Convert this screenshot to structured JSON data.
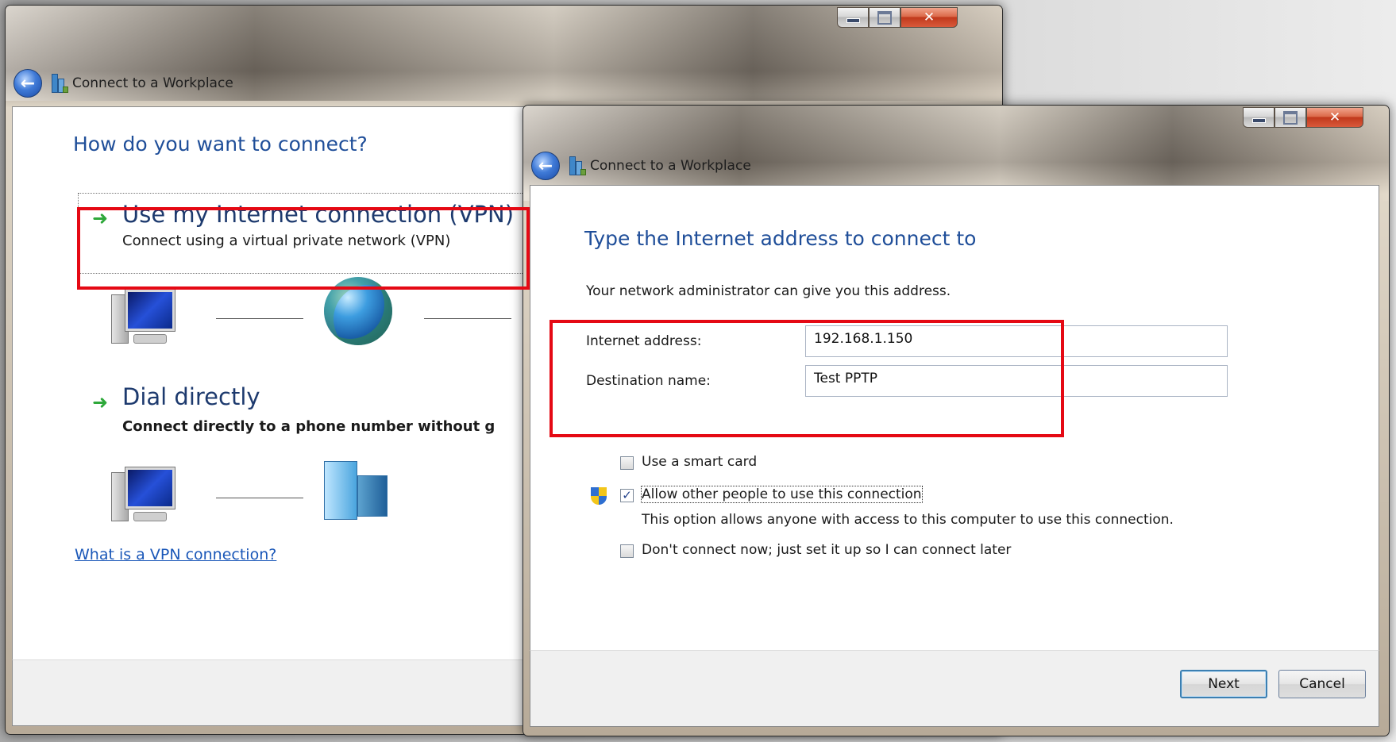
{
  "back_window": {
    "title": "Connect to a Workplace",
    "heading": "How do you want to connect?",
    "option_vpn": {
      "title": "Use my Internet connection (VPN)",
      "description": "Connect using a virtual private network (VPN)"
    },
    "option_dial": {
      "title": "Dial directly",
      "description": "Connect directly to a phone number without g"
    },
    "help_link": "What is a VPN connection?"
  },
  "front_window": {
    "title": "Connect to a Workplace",
    "heading": "Type the Internet address to connect to",
    "intro": "Your network administrator can give you this address.",
    "internet_address": {
      "label": "Internet address:",
      "value": "192.168.1.150"
    },
    "destination_name": {
      "label": "Destination name:",
      "value": "Test PPTP"
    },
    "checkboxes": [
      {
        "label": "Use a smart card",
        "checked": false
      },
      {
        "label": "Allow other people to use this connection",
        "checked": true
      },
      {
        "label": "Don't connect now; just set it up so I can connect later",
        "checked": false
      }
    ],
    "allow_note": "This option allows anyone with access to this computer to use this connection.",
    "next_button": "Next",
    "cancel_button": "Cancel"
  },
  "colors": {
    "highlight": "#e50914",
    "heading": "#1f4e99",
    "link": "#1a57b8"
  },
  "icons": [
    "back-arrow-icon",
    "workplace-icon",
    "green-arrow-icon",
    "computer-icon",
    "globe-icon",
    "building-icon",
    "uac-shield-icon",
    "minimize-icon",
    "maximize-icon",
    "close-icon"
  ]
}
